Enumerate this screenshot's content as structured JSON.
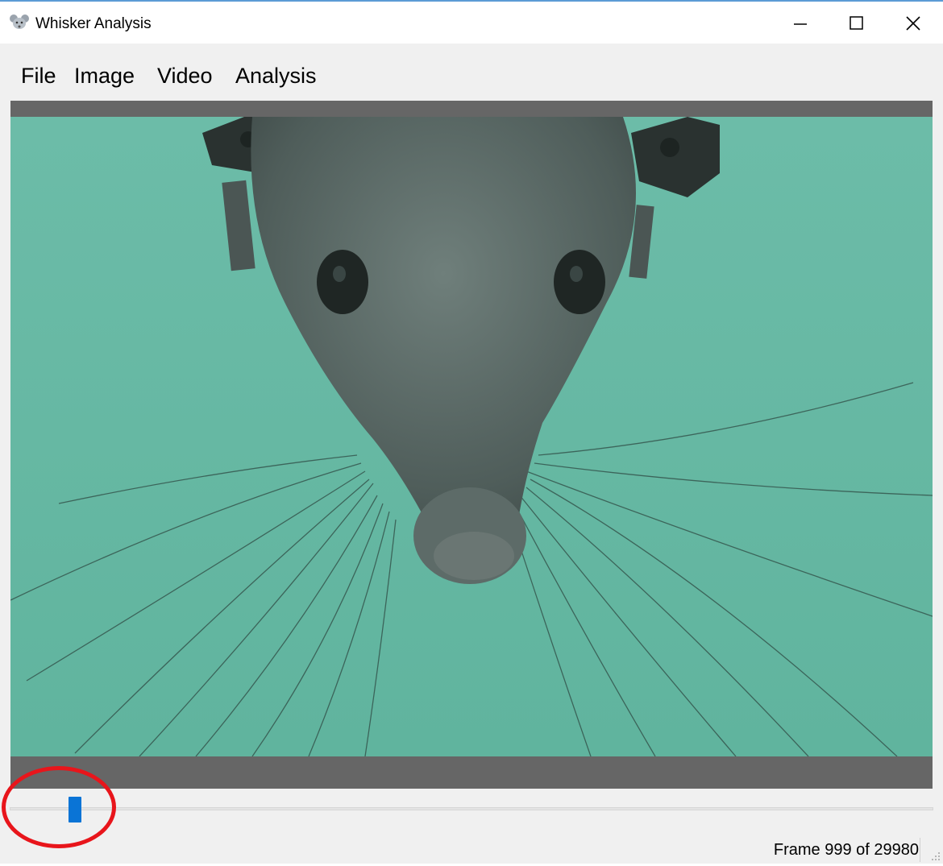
{
  "window": {
    "title": "Whisker Analysis",
    "icon": "mouse-icon",
    "controls": [
      "minimize-icon",
      "maximize-icon",
      "close-icon"
    ]
  },
  "menu": {
    "items": [
      {
        "label": "File"
      },
      {
        "label": "Image"
      },
      {
        "label": "Video"
      },
      {
        "label": "Analysis"
      }
    ]
  },
  "viewer": {
    "content": "video-frame",
    "background_color": "#67b9a4",
    "letterbox_color": "#666666"
  },
  "slider": {
    "current_frame": 999,
    "total_frames": 29980,
    "thumb_color": "#0a74d6"
  },
  "status": {
    "frame_text": "Frame 999 of 29980"
  },
  "annotation": {
    "color": "#e8151b",
    "marks": "slider-thumb"
  }
}
